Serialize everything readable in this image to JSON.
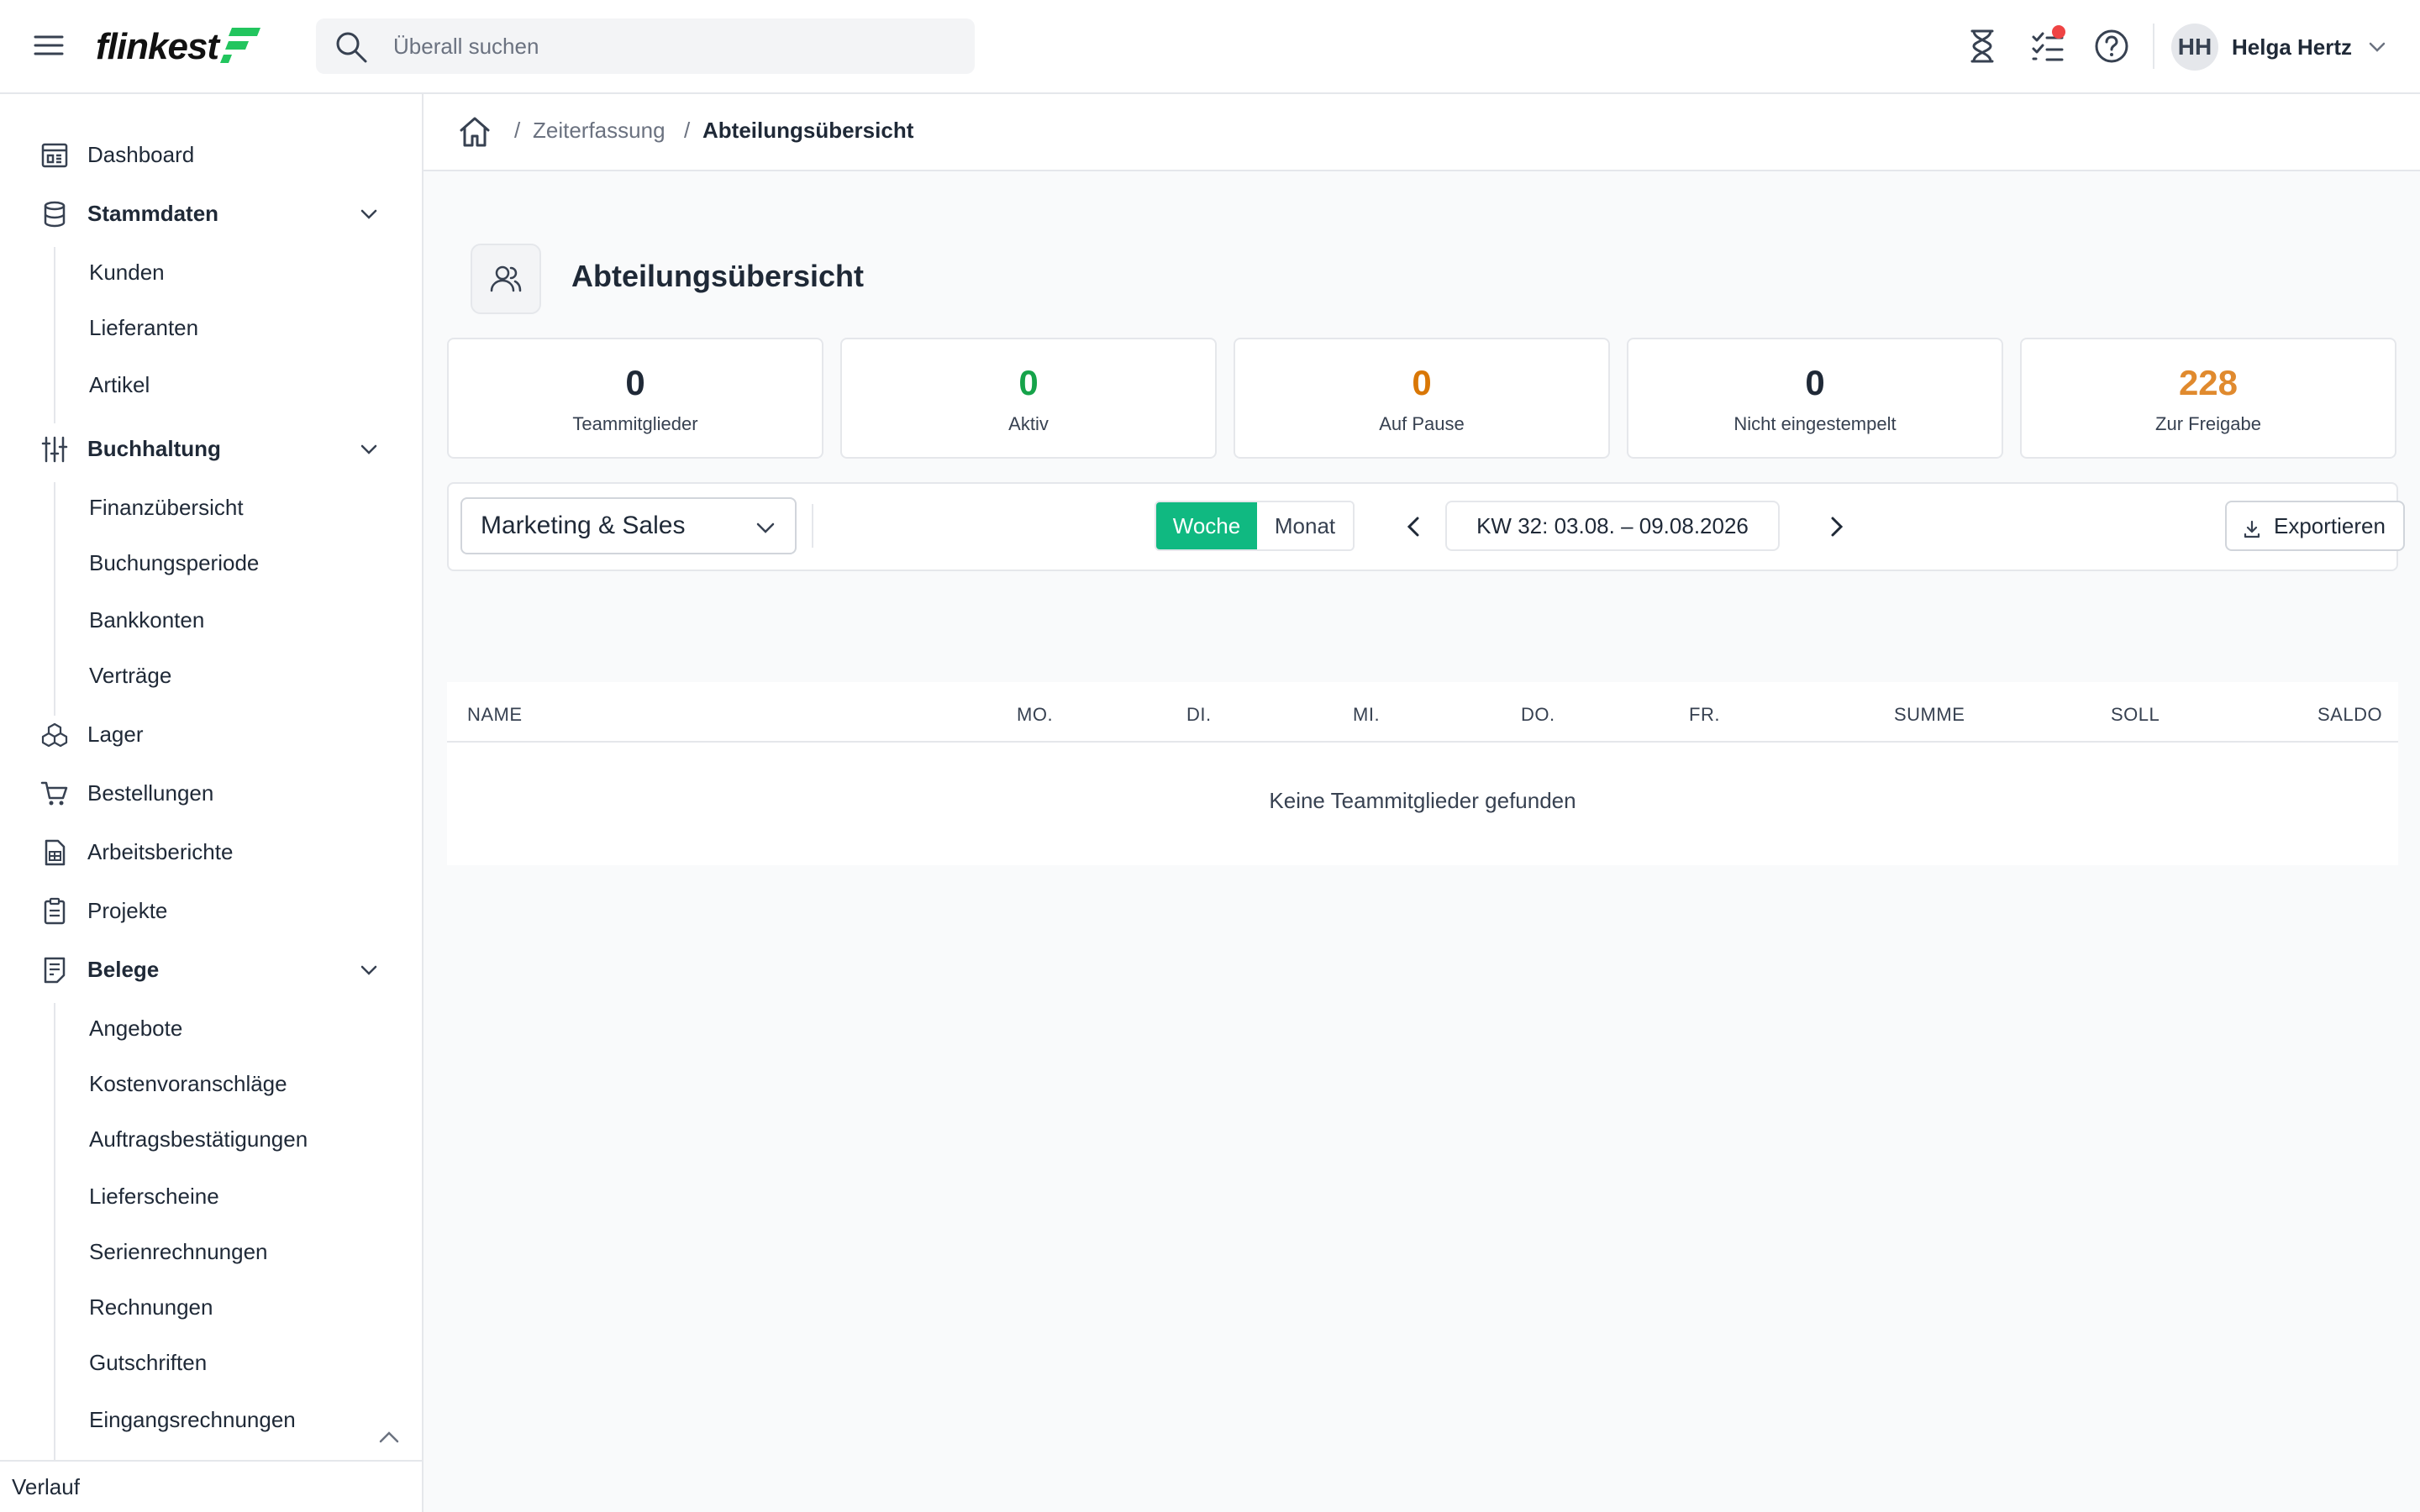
{
  "header": {
    "logo_text": "flinkest",
    "search_placeholder": "Überall suchen",
    "user_initials": "HH",
    "user_name": "Helga Hertz"
  },
  "icons": {
    "hamburger": "menu-icon",
    "search": "search-icon",
    "timer": "hourglass-icon",
    "tasks": "checklist-icon",
    "help": "help-icon",
    "user_menu": "chevron-down-icon"
  },
  "sidebar": {
    "items": [
      {
        "label": "Dashboard",
        "icon": "dashboard-icon"
      },
      {
        "label": "Stammdaten",
        "icon": "database-icon",
        "expanded": true,
        "children": [
          "Kunden",
          "Lieferanten",
          "Artikel"
        ]
      },
      {
        "label": "Buchhaltung",
        "icon": "sliders-icon",
        "expanded": true,
        "children": [
          "Finanzübersicht",
          "Buchungsperiode",
          "Bankkonten",
          "Verträge"
        ]
      },
      {
        "label": "Lager",
        "icon": "boxes-icon"
      },
      {
        "label": "Bestellungen",
        "icon": "cart-icon"
      },
      {
        "label": "Arbeitsberichte",
        "icon": "report-icon"
      },
      {
        "label": "Projekte",
        "icon": "clipboard-icon"
      },
      {
        "label": "Belege",
        "icon": "receipt-icon",
        "expanded": true,
        "children": [
          "Angebote",
          "Kostenvoranschläge",
          "Auftragsbestätigungen",
          "Lieferscheine",
          "Serienrechnungen",
          "Rechnungen",
          "Gutschriften",
          "Eingangsrechnungen"
        ]
      }
    ],
    "footer_label": "Verlauf"
  },
  "breadcrumb": {
    "items": [
      "Zeiterfassung",
      "Abteilungsübersicht"
    ]
  },
  "page": {
    "title": "Abteilungsübersicht"
  },
  "stats": [
    {
      "value": "0",
      "label": "Teammitglieder",
      "color": "#1f2937"
    },
    {
      "value": "0",
      "label": "Aktiv",
      "color": "#16a34a"
    },
    {
      "value": "0",
      "label": "Auf Pause",
      "color": "#d97706"
    },
    {
      "value": "0",
      "label": "Nicht eingestempelt",
      "color": "#1f2937"
    },
    {
      "value": "228",
      "label": "Zur Freigabe",
      "color": "#e08a2e"
    }
  ],
  "filters": {
    "department": "Marketing & Sales",
    "view_week": "Woche",
    "view_month": "Monat",
    "active_view": "Woche",
    "week_label": "KW 32: 03.08. – 09.08.2026",
    "export_label": "Exportieren"
  },
  "table": {
    "columns": [
      "NAME",
      "MO.",
      "DI.",
      "MI.",
      "DO.",
      "FR.",
      "SUMME",
      "SOLL",
      "SALDO"
    ],
    "rows": [],
    "empty_message": "Keine Teammitglieder gefunden"
  },
  "colors": {
    "accent": "#10b981",
    "brand_green": "#22c55e",
    "notification": "#ef4444"
  }
}
